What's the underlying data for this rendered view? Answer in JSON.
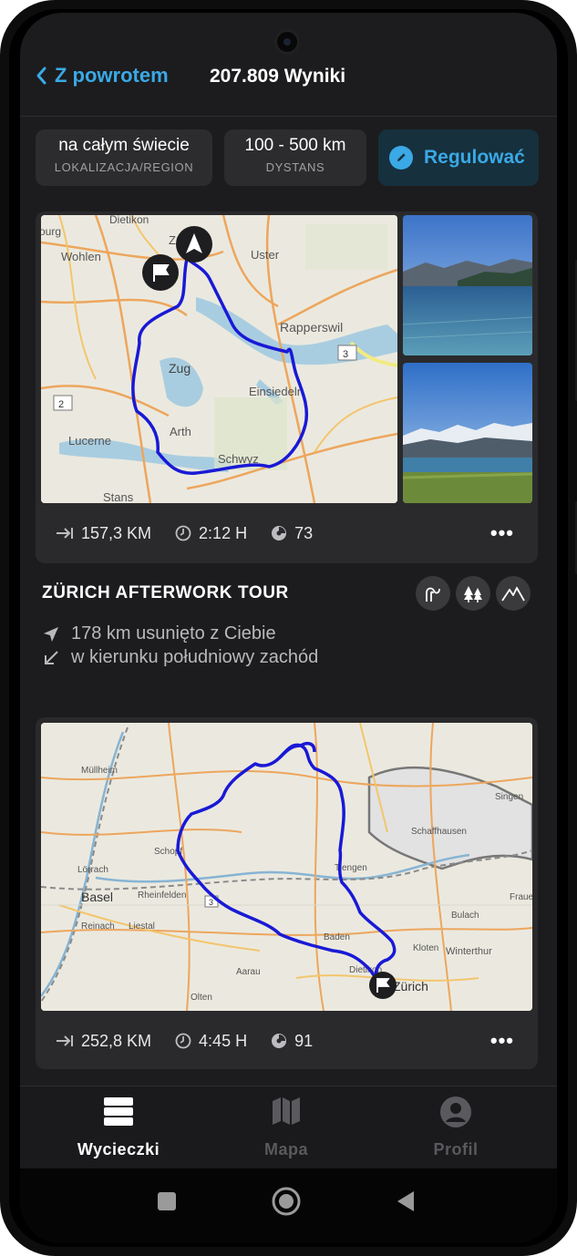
{
  "header": {
    "back_label": "Z powrotem",
    "results": "207.809 Wyniki"
  },
  "filters": [
    {
      "value": "na całym świecie",
      "label": "LOKALIZACJA/REGION"
    },
    {
      "value": "100 - 500 km",
      "label": "DYSTANS"
    }
  ],
  "adjust_label": "Regulować",
  "tour1": {
    "map_labels": [
      "Dietikon",
      "ourg",
      "Wohlen",
      "Zü",
      "Uster",
      "Rapperswil",
      "3",
      "Zug",
      "2",
      "Einsiedeln",
      "Arth",
      "Lucerne",
      "Schwyz",
      "Stans"
    ],
    "distance": "157,3 KM",
    "duration": "2:12 H",
    "score": "73",
    "more": "•••",
    "title": "ZÜRICH AFTERWORK TOUR",
    "badges": [
      "curves-icon",
      "forest-icon",
      "mountains-icon"
    ],
    "direction_distance": "178 km usunięto z Ciebie",
    "direction_heading": "w kierunku południowy zachód"
  },
  "tour2": {
    "map_labels": [
      "Müllheim",
      "Schopf",
      "Lörrach",
      "Basel",
      "Rheinfelden",
      "Reinach",
      "Liestal",
      "3",
      "Tiengen",
      "Schaffhausen",
      "Singen",
      "Bulach",
      "Winterthur",
      "Baden",
      "Kloten",
      "Dietikon",
      "Zürich",
      "Aarau",
      "Olten",
      "Fraue"
    ],
    "distance": "252,8 KM",
    "duration": "4:45 H",
    "score": "91",
    "more": "•••"
  },
  "nav": [
    {
      "label": "Wycieczki",
      "icon": "tours-icon",
      "active": true
    },
    {
      "label": "Mapa",
      "icon": "map-icon",
      "active": false
    },
    {
      "label": "Profil",
      "icon": "profile-icon",
      "active": false
    }
  ],
  "colors": {
    "accent": "#3aa9e6",
    "route": "#1919d6",
    "background": "#1c1c1e",
    "card": "#2a2a2c"
  }
}
